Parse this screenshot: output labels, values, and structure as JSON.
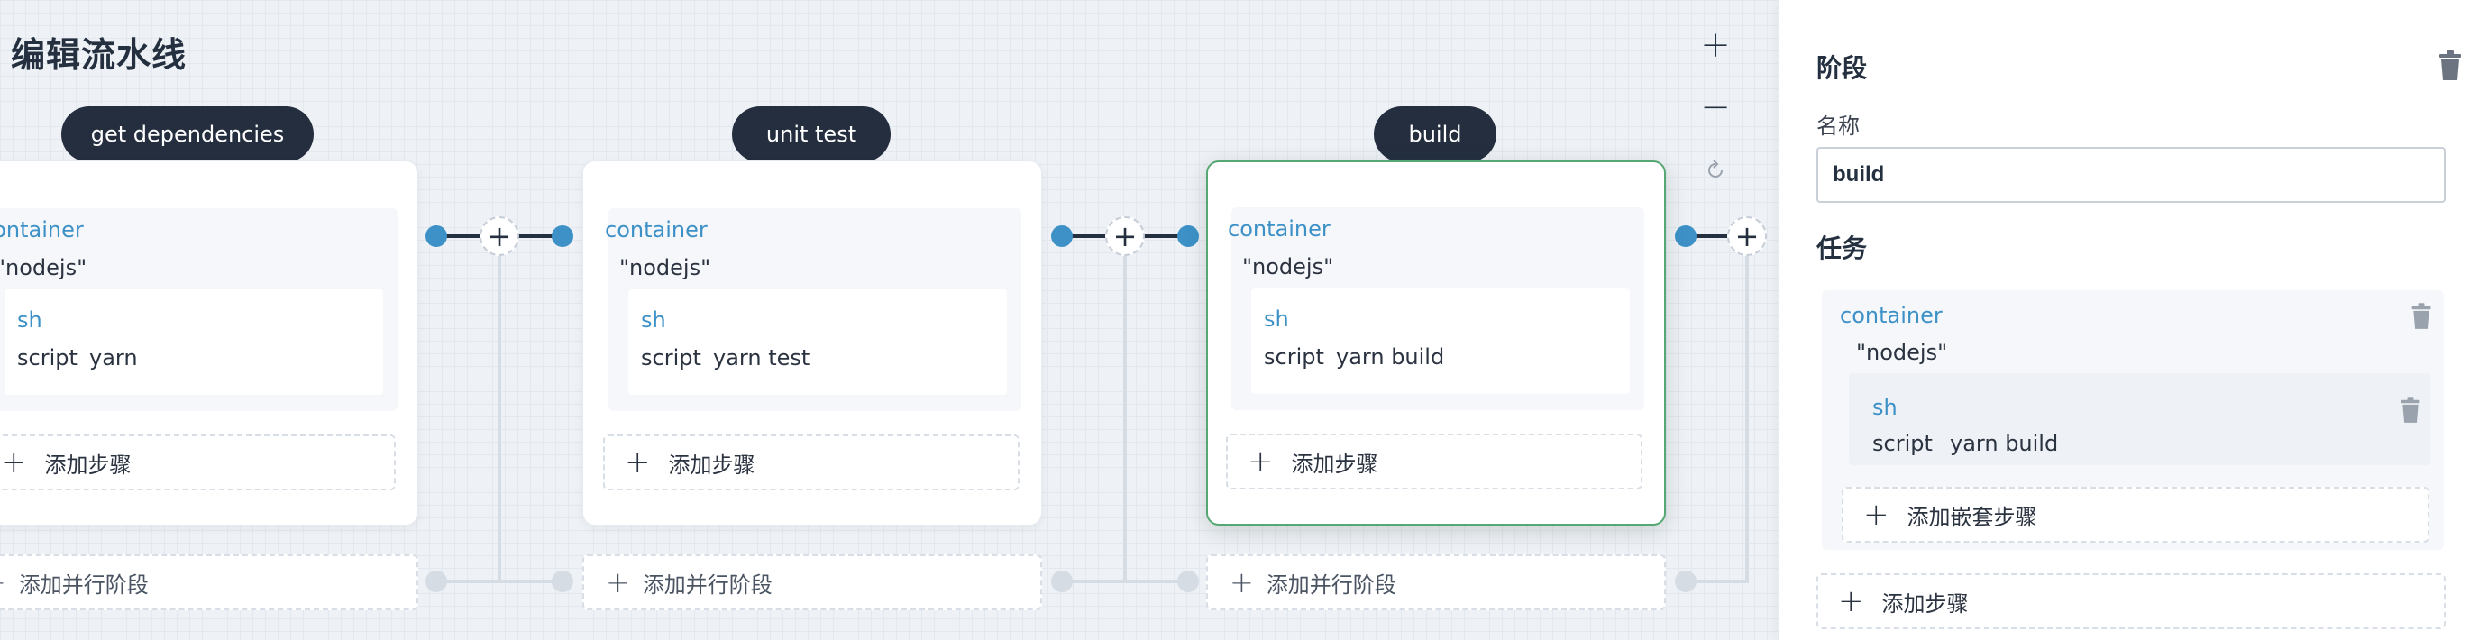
{
  "page": {
    "title": "编辑流水线"
  },
  "zoom_controls": {
    "zoom_in": "+",
    "zoom_out": "−"
  },
  "stages": [
    {
      "name": "get dependencies",
      "container_label": "container",
      "container_arg": "\"nodejs\"",
      "step_name": "sh",
      "step_key": "script",
      "step_value": "yarn",
      "add_step_label": "添加步骤",
      "add_parallel_label": "添加并行阶段",
      "selected": false
    },
    {
      "name": "unit test",
      "container_label": "container",
      "container_arg": "\"nodejs\"",
      "step_name": "sh",
      "step_key": "script",
      "step_value": "yarn test",
      "add_step_label": "添加步骤",
      "add_parallel_label": "添加并行阶段",
      "selected": false
    },
    {
      "name": "build",
      "container_label": "container",
      "container_arg": "\"nodejs\"",
      "step_name": "sh",
      "step_key": "script",
      "step_value": "yarn build",
      "add_step_label": "添加步骤",
      "add_parallel_label": "添加并行阶段",
      "selected": true
    }
  ],
  "panel": {
    "stage_heading": "阶段",
    "name_label": "名称",
    "name_value": "build",
    "task_heading": "任务",
    "task": {
      "container_label": "container",
      "container_arg": "\"nodejs\"",
      "step_name": "sh",
      "step_key": "script",
      "step_value": "yarn build",
      "add_nested_label": "添加嵌套步骤"
    },
    "add_step_label": "添加步骤"
  },
  "colors": {
    "accent": "#3d91c7",
    "pill": "#242e3f",
    "selected_border": "#55a873"
  },
  "icons": [
    "plus-icon",
    "minus-icon",
    "reset-icon",
    "trash-icon"
  ]
}
